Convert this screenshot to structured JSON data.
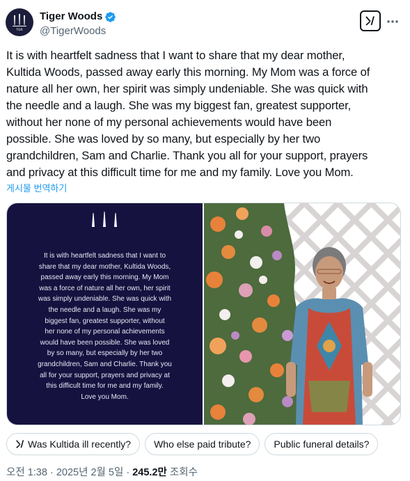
{
  "author": {
    "display_name": "Tiger Woods",
    "handle": "@TigerWoods",
    "verified_icon": "verified-badge-icon",
    "avatar_text": "TGR"
  },
  "tweet": {
    "lines": [
      "It is with heartfelt sadness that I want to share that my dear mother,",
      "Kultida Woods, passed away early this morning. My Mom was a force of",
      "nature all her own, her spirit was simply undeniable. She was quick with",
      "the needle and a laugh. She was my biggest fan, greatest supporter,",
      "without her none of my personal achievements would have been",
      "possible. She was loved by so many,  but especially by her two",
      "grandchildren, Sam and Charlie. Thank you all for your support, prayers",
      "and privacy at this difficult time for me and my family. Love you Mom."
    ],
    "translate_label": "게시물 번역하기"
  },
  "media": {
    "statement_lines": [
      "It is with heartfelt sadness that I want to",
      "share that my dear mother, Kultida Woods,",
      "passed away early this morning. My Mom",
      "was a force of nature all her own, her spirit",
      "was simply undeniable. She was quick with",
      "the needle and a laugh. She was my",
      "biggest fan, greatest supporter, without",
      "her none of my personal achievements",
      "would have been possible. She was loved",
      "by so many, but especially by her two",
      "grandchildren, Sam and Charlie. Thank you",
      "all for your support, prayers and privacy at",
      "this difficult time for me and my family.",
      "Love you Mom."
    ]
  },
  "chips": [
    "Was Kultida ill recently?",
    "Who else paid tribute?",
    "Public funeral details?"
  ],
  "meta": {
    "time": "오전 1:38",
    "separator": "·",
    "date": "2025년 2월 5일",
    "views_count": "245.2만",
    "views_label": "조회수"
  },
  "colors": {
    "accent": "#1d9bf0",
    "statement_bg": "#161240",
    "text_secondary": "#536471"
  }
}
